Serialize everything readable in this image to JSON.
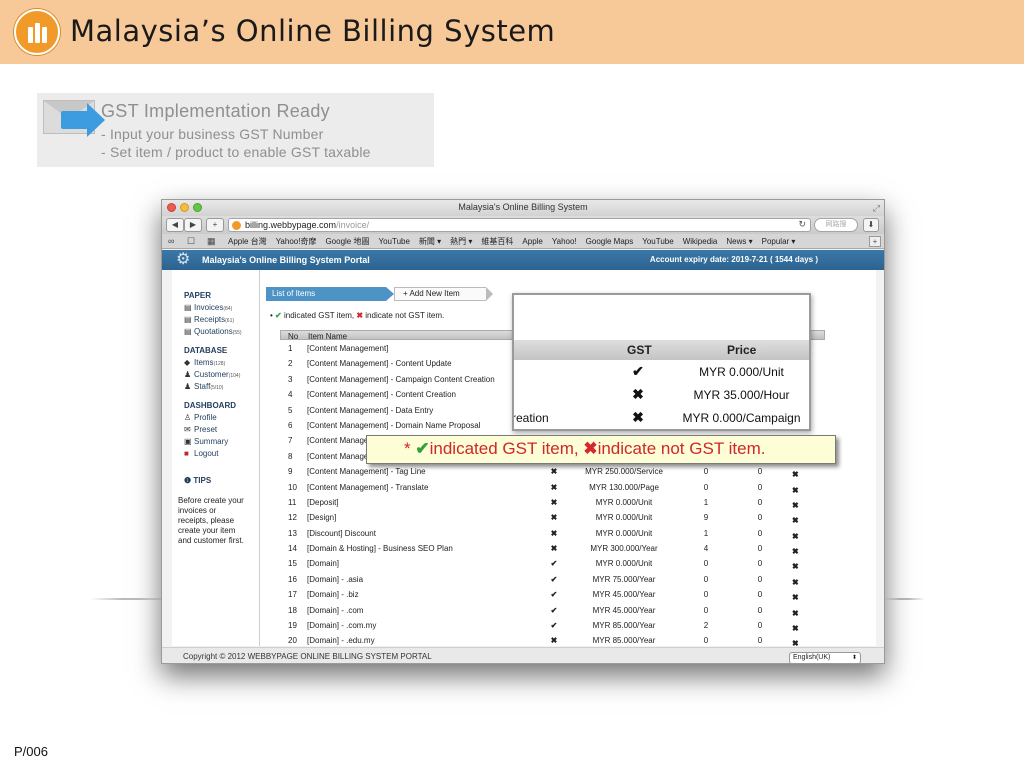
{
  "slide": {
    "title": "Malaysia’s Online Billing System",
    "page_number": "P/006"
  },
  "banner": {
    "title": "GST Implementation Ready",
    "line1": "- Input your business GST Number",
    "line2": "- Set item / product to enable GST taxable"
  },
  "browser": {
    "window_title": "Malaysia's Online Billing System",
    "url_host": "billing.webbypage.com",
    "url_path": "/invoice/",
    "search_placeholder": "网路搜",
    "bookmarks": [
      "Apple 台灣",
      "Yahoo!奇摩",
      "Google 地圖",
      "YouTube",
      "新聞 ▾",
      "熱門 ▾",
      "維基百科",
      "Apple",
      "Yahoo!",
      "Google Maps",
      "YouTube",
      "Wikipedia",
      "News ▾",
      "Popular ▾"
    ]
  },
  "portal": {
    "title": "Malaysia's Online Billing System Portal",
    "expiry": "Account expiry date: 2019-7-21 ( 1544 days )",
    "footer": "Copyright © 2012 WEBBYPAGE ONLINE BILLING SYSTEM PORTAL",
    "language": "English(UK)"
  },
  "sidebar": {
    "paper_label": "PAPER",
    "paper_items": [
      {
        "label": "Invoices",
        "count": "(84)"
      },
      {
        "label": "Receipts",
        "count": "(61)"
      },
      {
        "label": "Quotations",
        "count": "(55)"
      }
    ],
    "database_label": "DATABASE",
    "database_items": [
      {
        "label": "Items",
        "count": "(128)"
      },
      {
        "label": "Customer",
        "count": "(104)"
      },
      {
        "label": "Staff",
        "count": "(5/10)"
      }
    ],
    "dashboard_label": "DASHBOARD",
    "dashboard_items": [
      {
        "label": "Profile"
      },
      {
        "label": "Preset"
      },
      {
        "label": "Summary"
      },
      {
        "label": "Logout"
      }
    ],
    "tips_label": "TIPS",
    "tips_text": "Before create your invoices or receipts, please create your item and customer first."
  },
  "main": {
    "crumb_active": "List of Items",
    "crumb_add": "+ Add New Item",
    "legend_prefix": "•",
    "legend_gst": "indicated GST item,",
    "legend_non_gst": "indicate not GST item.",
    "col_no": "No",
    "col_name": "Item Name"
  },
  "rows": [
    {
      "no": "1",
      "name": "[Content Management]",
      "gst": "",
      "price": "",
      "a": "",
      "b": ""
    },
    {
      "no": "2",
      "name": "[Content Management] - Content Update",
      "gst": "",
      "price": "",
      "a": "",
      "b": ""
    },
    {
      "no": "3",
      "name": "[Content Management] - Campaign Content Creation",
      "gst": "",
      "price": "",
      "a": "",
      "b": ""
    },
    {
      "no": "4",
      "name": "[Content Management] - Content Creation",
      "gst": "",
      "price": "",
      "a": "",
      "b": ""
    },
    {
      "no": "5",
      "name": "[Content Management] - Data Entry",
      "gst": "",
      "price": "",
      "a": "",
      "b": ""
    },
    {
      "no": "6",
      "name": "[Content Management] - Domain Name Proposal",
      "gst": "",
      "price": "",
      "a": "",
      "b": ""
    },
    {
      "no": "7",
      "name": "[Content Managem",
      "gst": "",
      "price": "",
      "a": "",
      "b": ""
    },
    {
      "no": "8",
      "name": "[Content Managem",
      "gst": "",
      "price": "",
      "a": "",
      "b": ""
    },
    {
      "no": "9",
      "name": "[Content Management] - Tag Line",
      "gst": "✖",
      "price": "MYR 250.000/Service",
      "a": "0",
      "b": "0"
    },
    {
      "no": "10",
      "name": "[Content Management] - Translate",
      "gst": "✖",
      "price": "MYR 130.000/Page",
      "a": "0",
      "b": "0"
    },
    {
      "no": "11",
      "name": "[Deposit]",
      "gst": "✖",
      "price": "MYR 0.000/Unit",
      "a": "1",
      "b": "0"
    },
    {
      "no": "12",
      "name": "[Design]",
      "gst": "✖",
      "price": "MYR 0.000/Unit",
      "a": "9",
      "b": "0"
    },
    {
      "no": "13",
      "name": "[Discount] Discount",
      "gst": "✖",
      "price": "MYR 0.000/Unit",
      "a": "1",
      "b": "0"
    },
    {
      "no": "14",
      "name": "[Domain & Hosting] - Business SEO Plan",
      "gst": "✖",
      "price": "MYR 300.000/Year",
      "a": "4",
      "b": "0"
    },
    {
      "no": "15",
      "name": "[Domain]",
      "gst": "✔",
      "price": "MYR 0.000/Unit",
      "a": "0",
      "b": "0"
    },
    {
      "no": "16",
      "name": "[Domain] - .asia",
      "gst": "✔",
      "price": "MYR 75.000/Year",
      "a": "0",
      "b": "0"
    },
    {
      "no": "17",
      "name": "[Domain] - .biz",
      "gst": "✔",
      "price": "MYR 45.000/Year",
      "a": "0",
      "b": "0"
    },
    {
      "no": "18",
      "name": "[Domain] - .com",
      "gst": "✔",
      "price": "MYR 45.000/Year",
      "a": "0",
      "b": "0"
    },
    {
      "no": "19",
      "name": "[Domain] - .com.my",
      "gst": "✔",
      "price": "MYR 85.000/Year",
      "a": "2",
      "b": "0"
    },
    {
      "no": "20",
      "name": "[Domain] - .edu.my",
      "gst": "✖",
      "price": "MYR 85.000/Year",
      "a": "0",
      "b": "0"
    }
  ],
  "zoom": {
    "col_gst": "GST",
    "col_price": "Price",
    "rows": [
      {
        "name": "",
        "gst": "✔",
        "price": "MYR 0.000/Unit"
      },
      {
        "name": "",
        "gst": "✖",
        "price": "MYR 35.000/Hour"
      },
      {
        "name": "reation",
        "gst": "✖",
        "price": "MYR 0.000/Campaign"
      }
    ],
    "legend_star": "*",
    "legend_gst": "indicated GST item,",
    "legend_non_gst": "indicate not GST item."
  },
  "colors": {
    "header_bg": "#f8c998",
    "portal_blue": "#2c6390",
    "gst_yes": "#2fa23a",
    "gst_no": "#d8262c"
  },
  "icons": {
    "check": "check-icon",
    "cross": "cross-icon",
    "edit": "edit-icon",
    "delete": "delete-icon",
    "gear": "gear-icon"
  }
}
